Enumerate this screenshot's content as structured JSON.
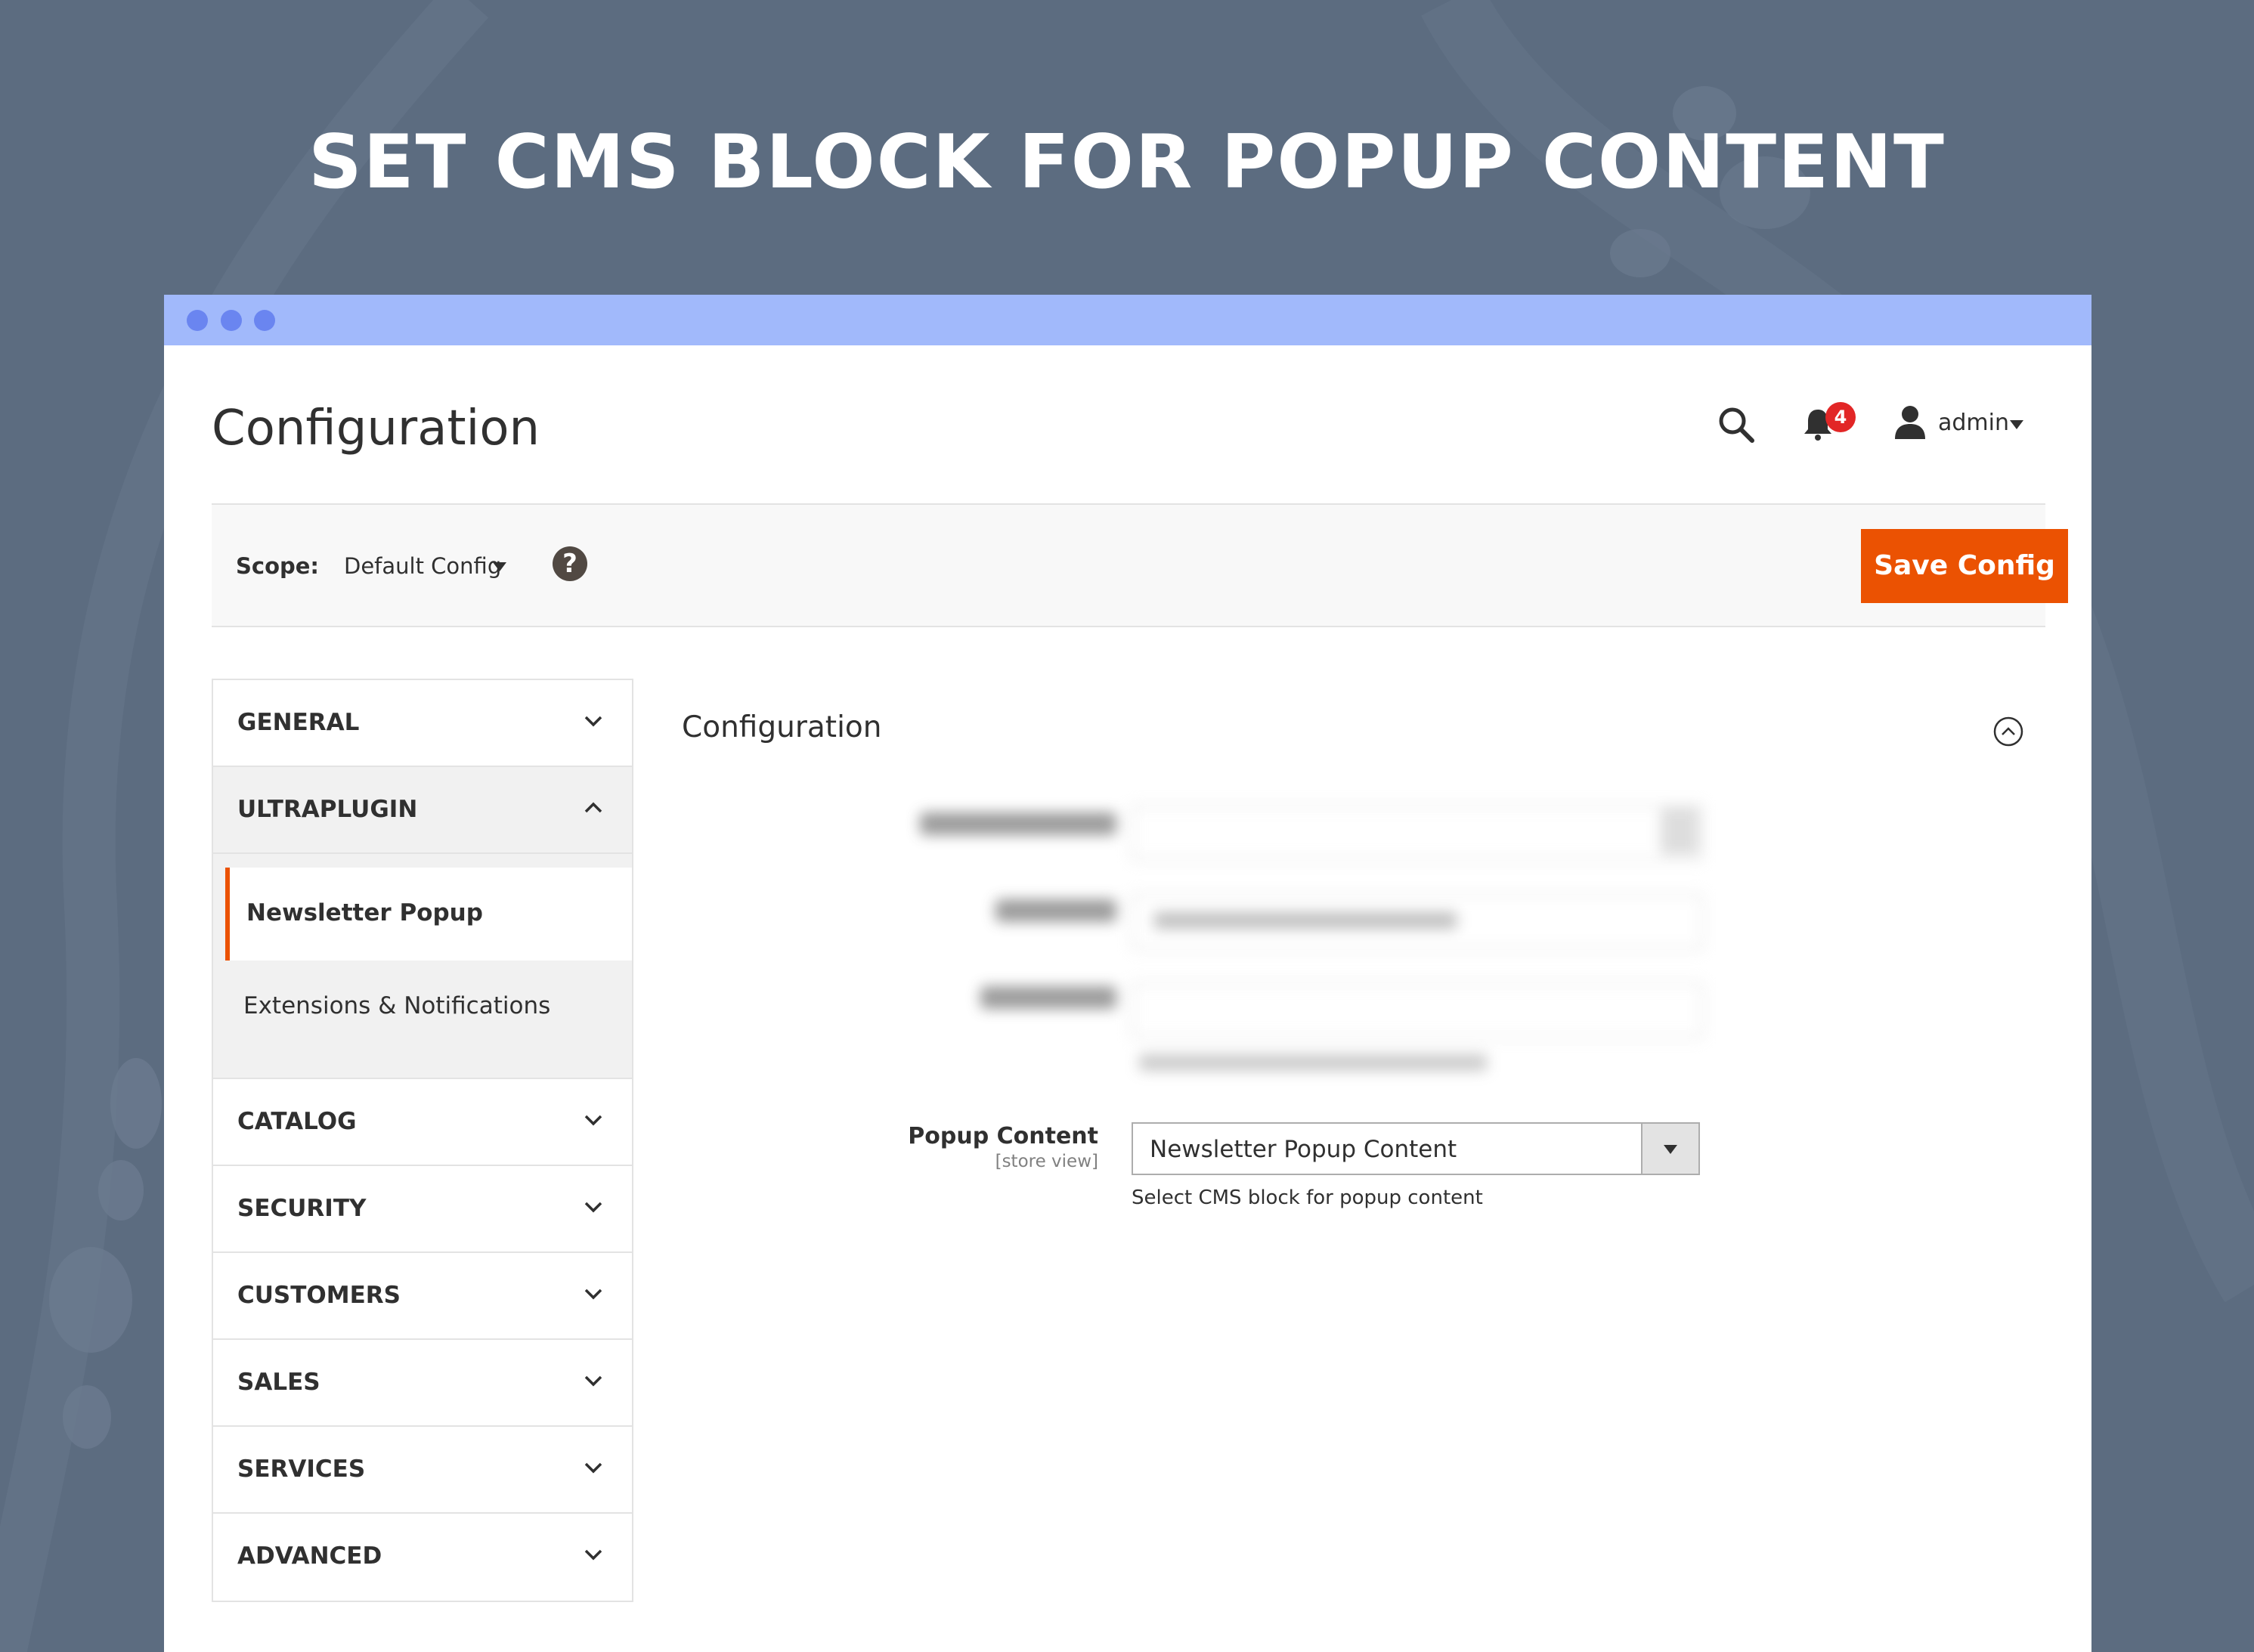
{
  "hero": {
    "title": "SET CMS BLOCK FOR POPUP CONTENT"
  },
  "header": {
    "page_title": "Configuration",
    "notification_count": "4",
    "user_name": "admin"
  },
  "scope_bar": {
    "label": "Scope:",
    "value": "Default Config",
    "help_symbol": "?",
    "save_label": "Save Config"
  },
  "sidebar": {
    "tabs": [
      {
        "label": "GENERAL",
        "state": "collapsed"
      },
      {
        "label": "ULTRAPLUGIN",
        "state": "expanded"
      },
      {
        "label": "CATALOG",
        "state": "collapsed"
      },
      {
        "label": "SECURITY",
        "state": "collapsed"
      },
      {
        "label": "CUSTOMERS",
        "state": "collapsed"
      },
      {
        "label": "SALES",
        "state": "collapsed"
      },
      {
        "label": "SERVICES",
        "state": "collapsed"
      },
      {
        "label": "ADVANCED",
        "state": "collapsed"
      }
    ],
    "ultraplugin_items": [
      {
        "label": "Newsletter Popup",
        "active": true
      },
      {
        "label": "Extensions & Notifications",
        "active": false
      }
    ]
  },
  "main": {
    "section_title": "Configuration",
    "popup_content": {
      "label": "Popup Content",
      "scope": "[store view]",
      "value": "Newsletter Popup Content",
      "note": "Select CMS block for popup content"
    }
  },
  "colors": {
    "background": "#5c6c80",
    "titlebar": "#a1b9fb",
    "accent": "#eb5202",
    "badge": "#e22626"
  },
  "icons": [
    "search-icon",
    "bell-icon",
    "user-icon",
    "help-icon",
    "chevron-down-icon",
    "chevron-up-icon",
    "collapse-circle-icon"
  ]
}
